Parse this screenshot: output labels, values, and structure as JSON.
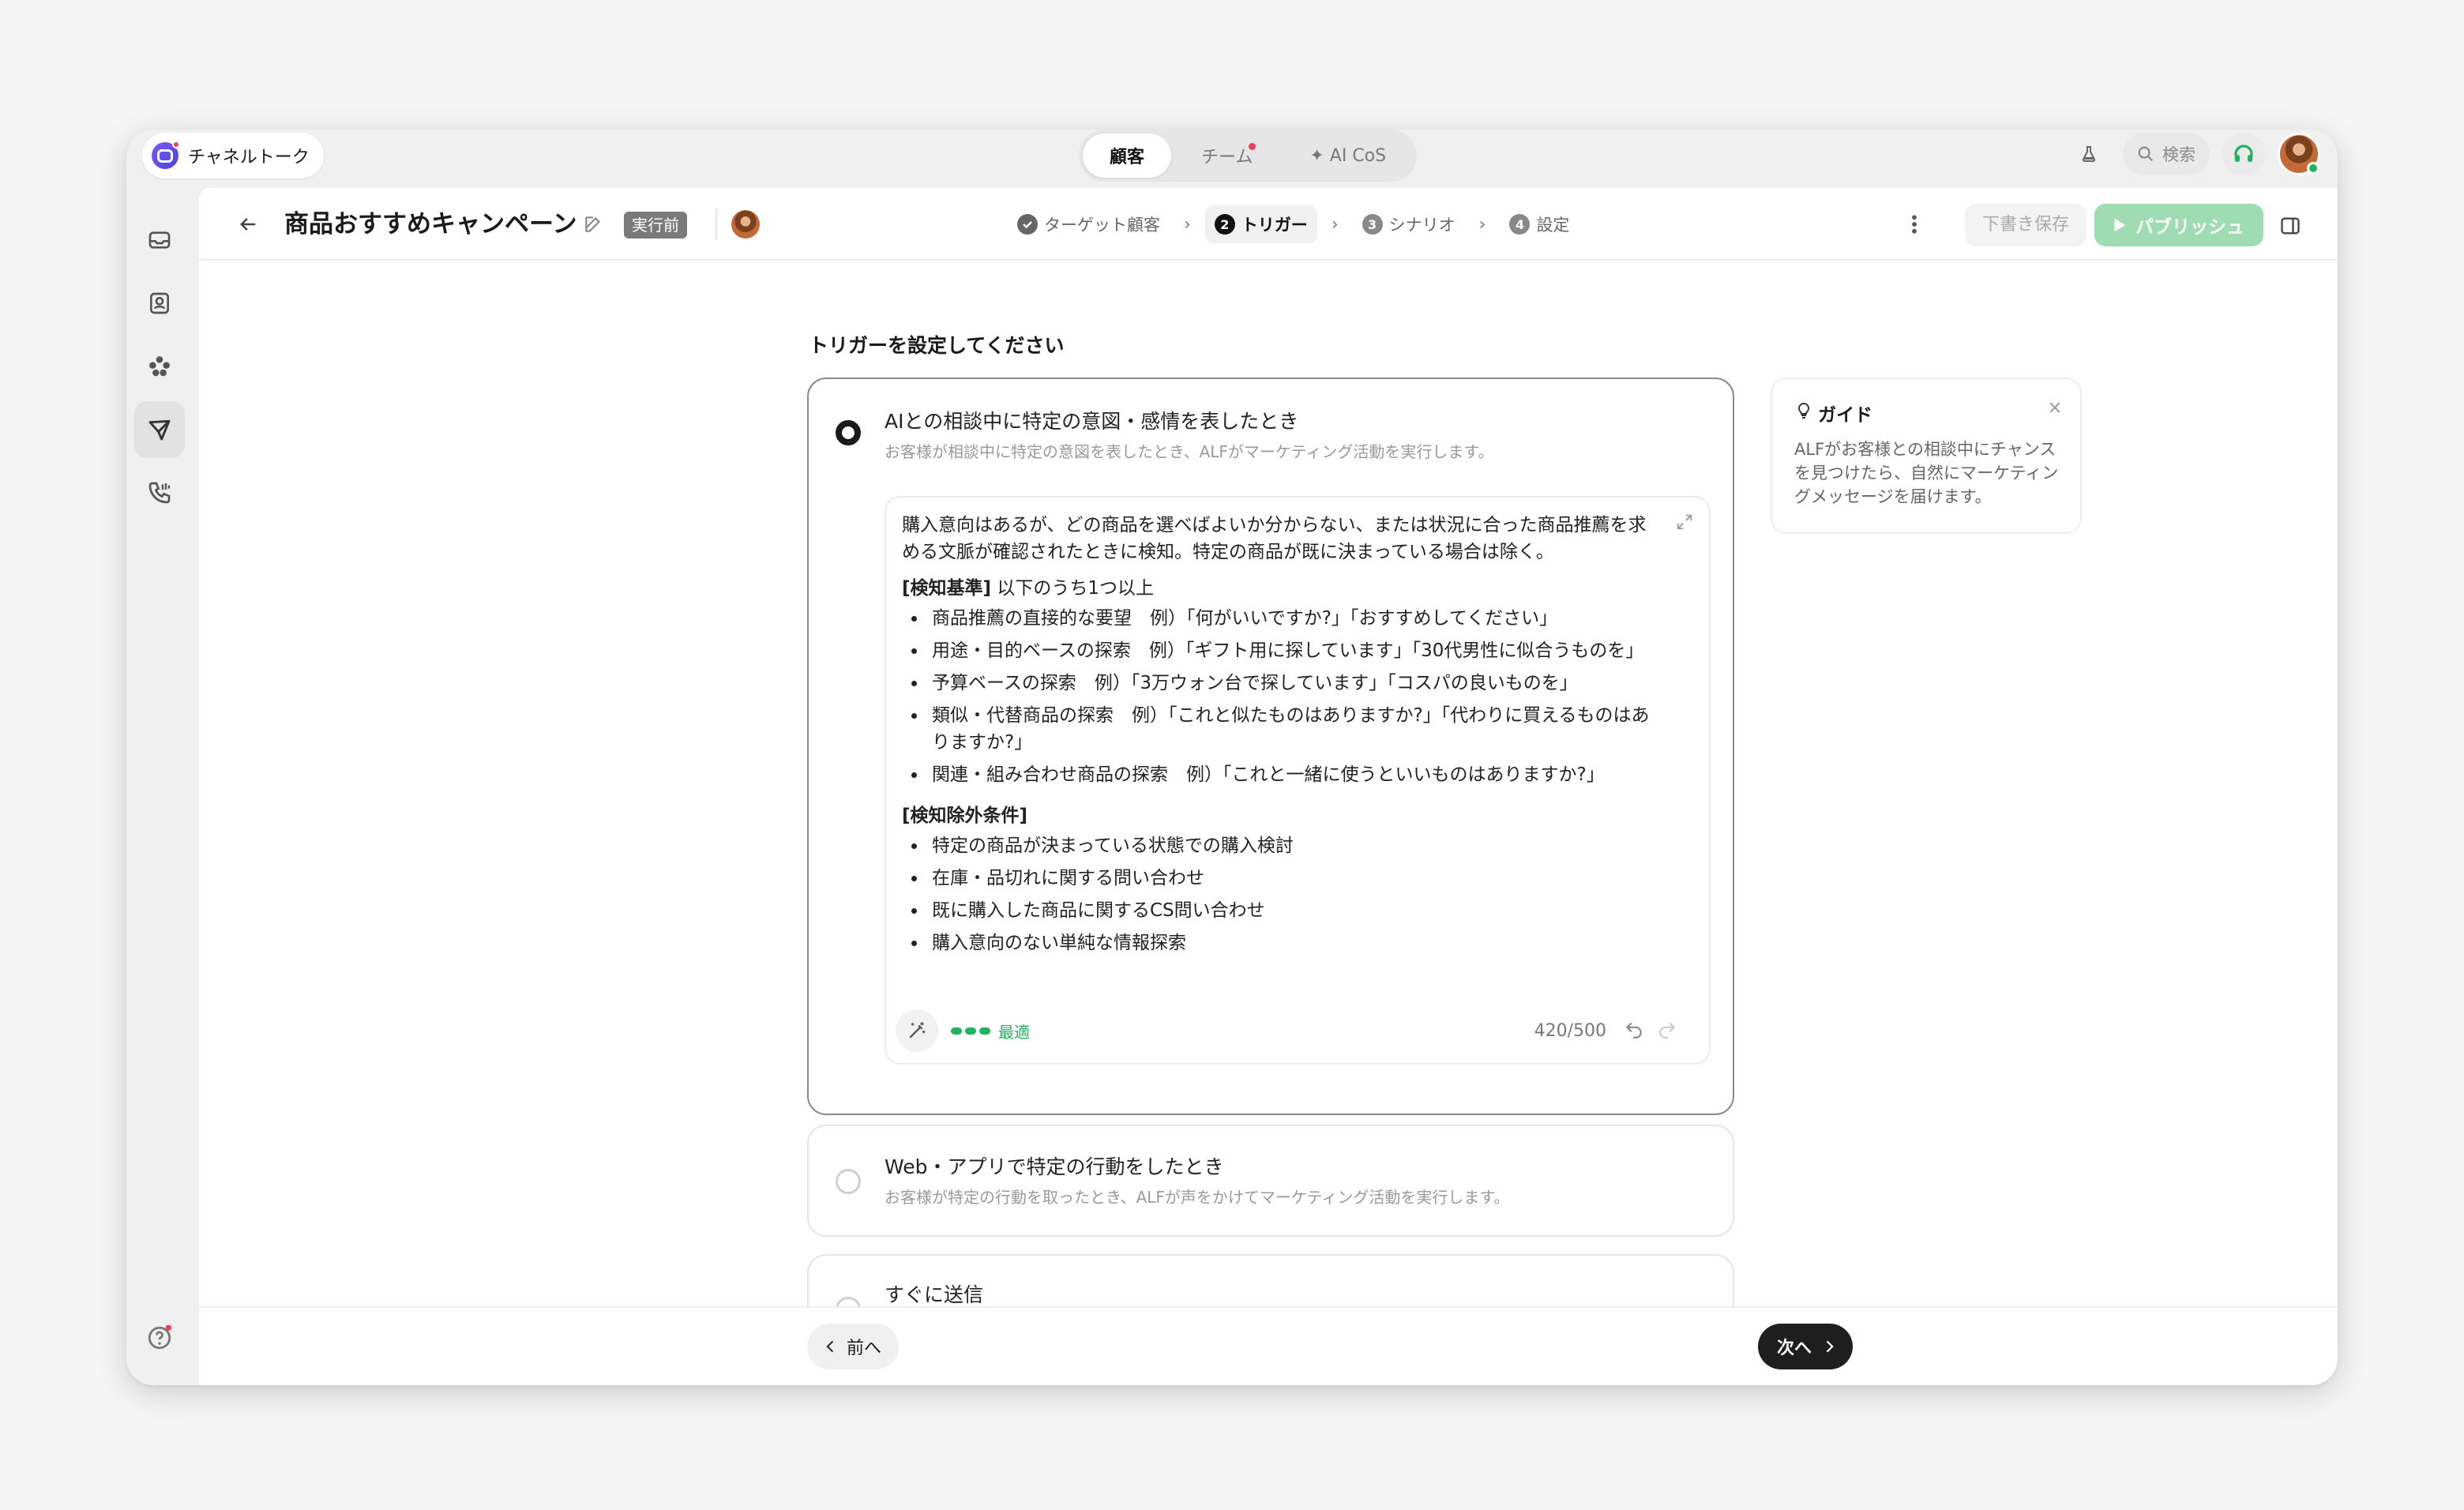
{
  "topbar": {
    "brand": "チャネルトーク",
    "tabs": [
      {
        "label": "顧客",
        "active": true
      },
      {
        "label": "チーム",
        "badge": true
      },
      {
        "label": "✦ AI CoS"
      }
    ],
    "search_label": "検索"
  },
  "sidebar": {
    "items": [
      "inbox-icon",
      "contacts-icon",
      "integrations-icon",
      "campaign-icon",
      "call-icon"
    ],
    "bottom": [
      "help-icon",
      "settings-icon"
    ]
  },
  "header": {
    "title": "商品おすすめキャンペーン",
    "status": "実行前",
    "steps": [
      {
        "label": "ターゲット顧客",
        "num": "✓",
        "done": true
      },
      {
        "label": "トリガー",
        "num": "2",
        "active": true
      },
      {
        "label": "シナリオ",
        "num": "3"
      },
      {
        "label": "設定",
        "num": "4"
      }
    ],
    "draft_label": "下書き保存",
    "publish_label": "パブリッシュ"
  },
  "content": {
    "section_title": "トリガーを設定してください",
    "options": [
      {
        "title": "AIとの相談中に特定の意図・感情を表したとき",
        "desc": "お客様が相談中に特定の意図を表したとき、ALFがマーケティング活動を実行します。",
        "selected": true
      },
      {
        "title": "Web・アプリで特定の行動をしたとき",
        "desc": "お客様が特定の行動を取ったとき、ALFが声をかけてマーケティング活動を実行します。",
        "selected": false
      },
      {
        "title": "すぐに送信",
        "selected": false
      }
    ],
    "prompt": {
      "intro": "購入意向はあるが、どの商品を選べばよいか分からない、または状況に合った商品推薦を求める文脈が確認されたときに検知。特定の商品が既に決まっている場合は除く。",
      "criteria_head": "[検知基準]",
      "criteria_tail": " 以下のうち1つ以上",
      "criteria": [
        "商品推薦の直接的な要望　例）「何がいいですか?」「おすすめしてください」",
        "用途・目的ベースの探索　例）「ギフト用に探しています」「30代男性に似合うものを」",
        "予算ベースの探索　例）「3万ウォン台で探しています」「コスパの良いものを」",
        "類似・代替商品の探索　例）「これと似たものはありますか?」「代わりに買えるものはありますか?」",
        "関連・組み合わせ商品の探索　例）「これと一緒に使うといいものはありますか?」"
      ],
      "exclusion_head": "[検知除外条件]",
      "exclusions": [
        "特定の商品が決まっている状態での購入検討",
        "在庫・品切れに関する問い合わせ",
        "既に購入した商品に関するCS問い合わせ",
        "購入意向のない単純な情報探索"
      ],
      "quality": "最適",
      "quality_level": 3,
      "char_count": "420/500"
    },
    "guide": {
      "title": "ガイド",
      "text": "ALFがお客様との相談中にチャンスを見つけたら、自然にマーケティングメッセージを届けます。"
    }
  },
  "footer": {
    "prev_label": "前へ",
    "next_label": "次へ"
  },
  "colors": {
    "accent_green": "#21b35c",
    "publish_disabled": "#9fdcb3",
    "brand_purple": "#5b47f0",
    "badge_red": "#f23c58"
  }
}
